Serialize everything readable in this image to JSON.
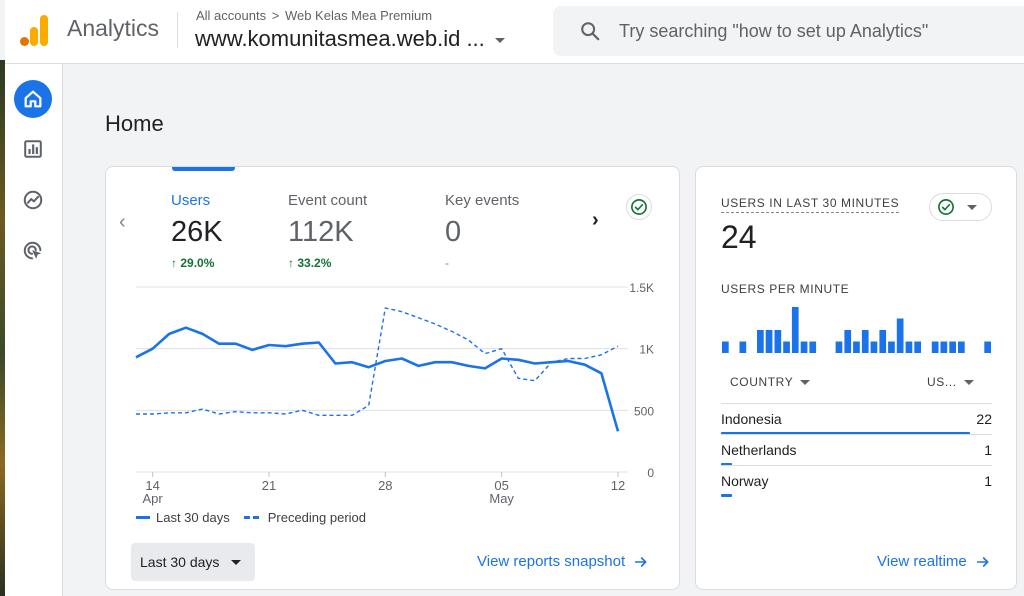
{
  "header": {
    "app_name": "Analytics",
    "breadcrumb_root": "All accounts",
    "breadcrumb_separator": ">",
    "breadcrumb_account": "Web Kelas Mea Premium",
    "property": "www.komunitasmea.web.id ...",
    "search_placeholder": "Try searching \"how to set up Analytics\""
  },
  "sidebar": {
    "items": [
      {
        "name": "home",
        "icon": "home-icon",
        "active": true
      },
      {
        "name": "reports",
        "icon": "bar-chart-icon",
        "active": false
      },
      {
        "name": "explore",
        "icon": "explore-icon",
        "active": false
      },
      {
        "name": "advertising",
        "icon": "advertising-icon",
        "active": false
      }
    ]
  },
  "page": {
    "title": "Home"
  },
  "overview": {
    "metrics": [
      {
        "label": "Users",
        "value": "26K",
        "change": "29.0%",
        "selected": true
      },
      {
        "label": "Event count",
        "value": "112K",
        "change": "33.2%",
        "selected": false
      },
      {
        "label": "Key events",
        "value": "0",
        "change": "-",
        "selected": false
      }
    ],
    "legend_current": "Last 30 days",
    "legend_previous": "Preceding period",
    "date_range": "Last 30 days",
    "view_link": "View reports snapshot",
    "accent": "#1a73e8"
  },
  "chart_data": {
    "type": "line",
    "y_ticks": [
      "1.5K",
      "1K",
      "500",
      "0"
    ],
    "y_tick_values": [
      1500,
      1000,
      500,
      0
    ],
    "ylim": [
      0,
      1500
    ],
    "x_ticks": [
      {
        "day": "14",
        "month": "Apr",
        "index": 1
      },
      {
        "day": "21",
        "month": "",
        "index": 8
      },
      {
        "day": "28",
        "month": "",
        "index": 15
      },
      {
        "day": "05",
        "month": "May",
        "index": 22
      },
      {
        "day": "12",
        "month": "",
        "index": 29
      }
    ],
    "series": [
      {
        "name": "Last 30 days",
        "style": "solid",
        "values": [
          930,
          1000,
          1120,
          1170,
          1120,
          1040,
          1040,
          990,
          1030,
          1020,
          1040,
          1050,
          880,
          890,
          850,
          900,
          920,
          860,
          890,
          890,
          860,
          840,
          920,
          910,
          880,
          890,
          900,
          870,
          800,
          330
        ]
      },
      {
        "name": "Preceding period",
        "style": "dashed",
        "values": [
          470,
          470,
          480,
          480,
          510,
          470,
          490,
          480,
          480,
          470,
          500,
          460,
          460,
          460,
          540,
          1330,
          1300,
          1250,
          1200,
          1140,
          1070,
          960,
          1000,
          760,
          740,
          890,
          920,
          920,
          950,
          1020
        ]
      }
    ],
    "grid": true,
    "legend_position": "bottom-left"
  },
  "realtime": {
    "label": "USERS IN LAST 30 MINUTES",
    "value": "24",
    "per_minute_label": "USERS PER MINUTE",
    "per_minute": [
      1,
      0,
      1,
      0,
      2,
      2,
      2,
      1,
      4,
      1,
      1,
      0,
      0,
      1,
      2,
      1,
      2,
      1,
      2,
      1,
      3,
      1,
      1,
      0,
      1,
      1,
      1,
      1,
      0,
      0,
      1
    ],
    "col_country": "COUNTRY",
    "col_users": "US...",
    "rows": [
      {
        "country": "Indonesia",
        "users": "22",
        "share": 0.917
      },
      {
        "country": "Netherlands",
        "users": "1",
        "share": 0.042
      },
      {
        "country": "Norway",
        "users": "1",
        "share": 0.042
      }
    ],
    "view_link": "View realtime"
  }
}
